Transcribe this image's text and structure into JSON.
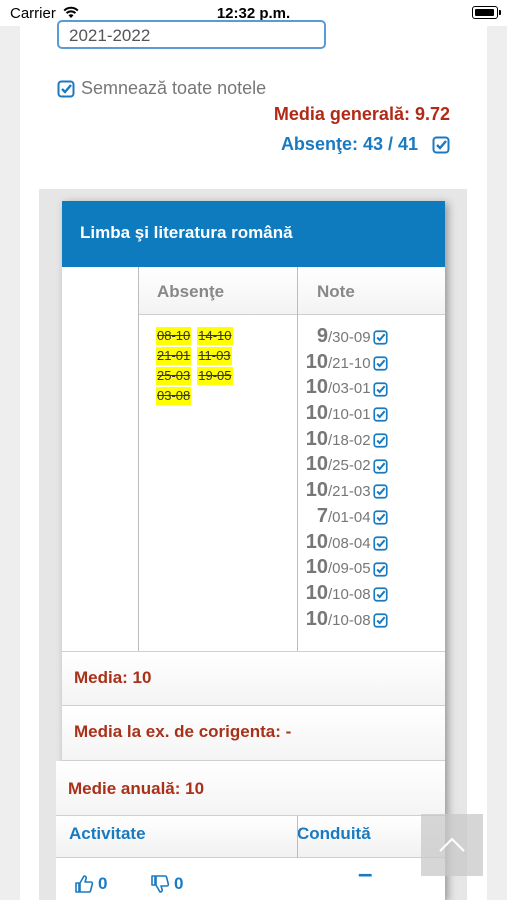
{
  "status_bar": {
    "carrier": "Carrier",
    "time": "12:32 p.m."
  },
  "year_select": {
    "value": "2021-2022"
  },
  "sign_all": {
    "label": "Semnează toate notele"
  },
  "summary": {
    "media_generala": "Media generală: 9.72",
    "absente": "Absenţe: 43 / 41"
  },
  "subject": {
    "title": "Limba şi literatura română",
    "headers": {
      "absente": "Absenţe",
      "note": "Note"
    },
    "absences": [
      "08-10",
      "14-10",
      "21-01",
      "11-03",
      "25-03",
      "19-05",
      "03-08"
    ],
    "notes": [
      {
        "value": "9",
        "date": "/30-09"
      },
      {
        "value": "10",
        "date": "/21-10"
      },
      {
        "value": "10",
        "date": "/03-01"
      },
      {
        "value": "10",
        "date": "/10-01"
      },
      {
        "value": "10",
        "date": "/18-02"
      },
      {
        "value": "10",
        "date": "/25-02"
      },
      {
        "value": "10",
        "date": "/21-03"
      },
      {
        "value": "7",
        "date": "/01-04"
      },
      {
        "value": "10",
        "date": "/08-04"
      },
      {
        "value": "10",
        "date": "/09-05"
      },
      {
        "value": "10",
        "date": "/10-08"
      },
      {
        "value": "10",
        "date": "/10-08"
      }
    ],
    "media": "Media: 10",
    "media_corigenta": "Media la ex. de corigenta: -",
    "medie_anuala": "Medie anuală: 10",
    "activitate_label": "Activitate",
    "conduita_label": "Conduită",
    "likes": "0",
    "dislikes": "0",
    "conduita_value": "–"
  },
  "colors": {
    "accent_blue": "#0d7bbd",
    "link_blue": "#1a7ac0",
    "grade_red": "#b22a17",
    "absence_highlight": "#ffff00"
  },
  "icons": {
    "check": "check-square-icon",
    "like": "thumbs-up-icon",
    "dislike": "thumbs-down-icon",
    "scroll_top": "chevron-up-icon"
  }
}
